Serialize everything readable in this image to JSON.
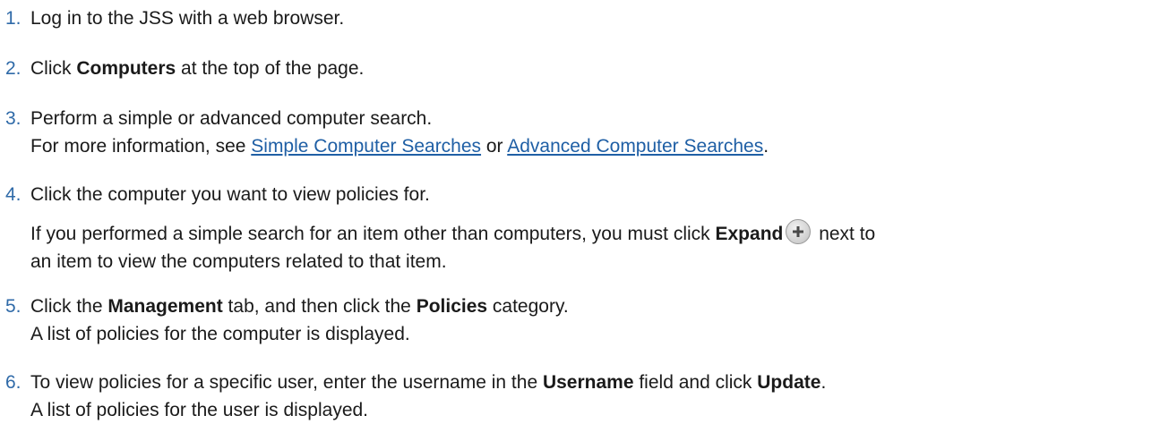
{
  "steps": [
    {
      "number": "1.",
      "text": "Log in to the JSS with a web browser."
    },
    {
      "number": "2.",
      "pre": "Click ",
      "bold": "Computers",
      "post": " at the top of the page."
    },
    {
      "number": "3.",
      "text": "Perform a simple or advanced computer search.",
      "line2_pre": "For more information, see ",
      "link1": "Simple Computer Searches",
      "line2_mid": " or ",
      "link2": "Advanced Computer Searches",
      "line2_post": "."
    },
    {
      "number": "4.",
      "text": "Click the computer you want to view policies for.",
      "sub_pre": "If you performed a simple search for an item other than computers, you must click ",
      "sub_bold": "Expand",
      "sub_icon": "expand-plus-icon",
      "sub_post": " next to",
      "sub_line2": "an item to view the computers related to that item."
    },
    {
      "number": "5.",
      "pre": "Click the ",
      "bold1": "Management",
      "mid": " tab, and then click the ",
      "bold2": "Policies",
      "post": " category.",
      "line2": "A list of policies for the computer is displayed."
    },
    {
      "number": "6.",
      "pre": "To view policies for a specific user, enter the username in the ",
      "bold1": "Username",
      "mid": " field and click ",
      "bold2": "Update",
      "post": ".",
      "line2": "A list of policies for the user is displayed."
    }
  ]
}
